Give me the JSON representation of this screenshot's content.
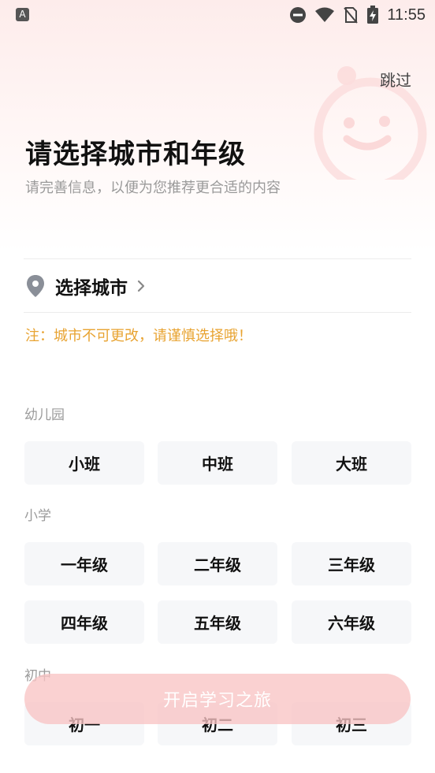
{
  "status_bar": {
    "left_icon": "A",
    "time": "11:55",
    "icons": [
      "dnd-icon",
      "wifi-icon",
      "no-sim-icon",
      "battery-charging-icon"
    ]
  },
  "header": {
    "skip": "跳过",
    "title": "请选择城市和年级",
    "subtitle": "请完善信息，以便为您推荐更合适的内容"
  },
  "city": {
    "label": "选择城市",
    "note": "注：城市不可更改，请谨慎选择哦！"
  },
  "sections": {
    "kindergarten": {
      "label": "幼儿园",
      "grades": [
        "小班",
        "中班",
        "大班"
      ]
    },
    "primary": {
      "label": "小学",
      "grades": [
        "一年级",
        "二年级",
        "三年级",
        "四年级",
        "五年级",
        "六年级"
      ]
    },
    "junior": {
      "label": "初中",
      "grades": [
        "初一",
        "初二",
        "初三"
      ]
    }
  },
  "start_button": "开启学习之旅",
  "colors": {
    "note": "#e8a331",
    "button_bg": "#f8c4c4",
    "chip_bg": "#f6f7f9"
  }
}
